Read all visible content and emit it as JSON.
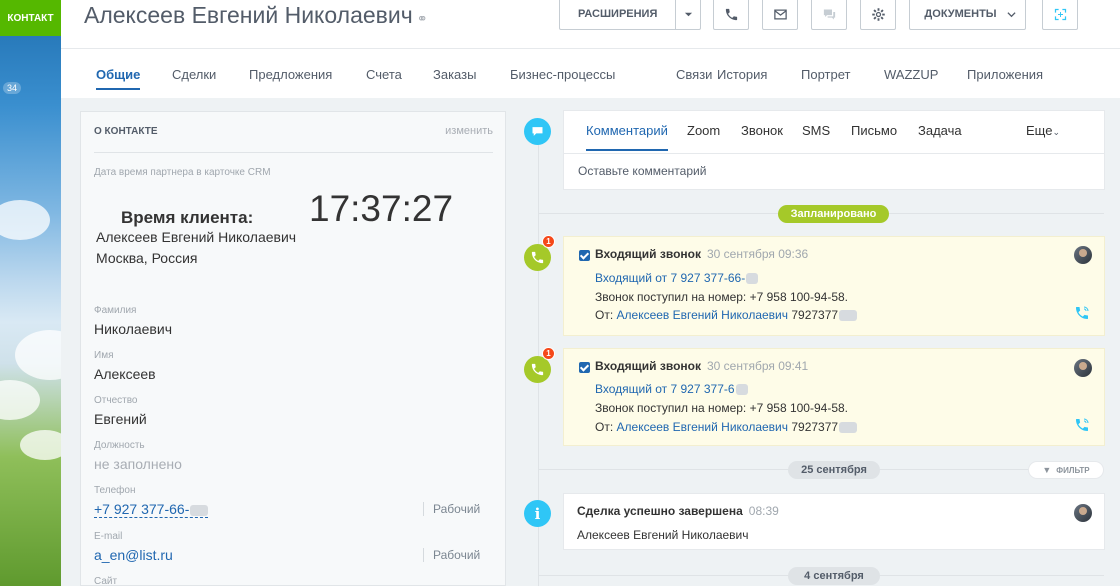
{
  "left_tab": "КОНТАКТ",
  "left_counter": "34",
  "header": {
    "title": "Алексеев Евгений  Николаевич",
    "extensions_label": "РАСШИРЕНИЯ",
    "documents_label": "ДОКУМЕНТЫ"
  },
  "tabs": [
    "Общие",
    "Сделки",
    "Предложения",
    "Счета",
    "Заказы",
    "Бизнес-процессы",
    "Связи",
    "История",
    "Портрет",
    "WAZZUP",
    "Приложения"
  ],
  "about": {
    "heading": "О КОНТАКТЕ",
    "edit": "изменить",
    "partner_time_label": "Дата время партнера в карточке CRM",
    "client_time_label": "Время клиента:",
    "client_name": "Алексеев Евгений Николаевич",
    "client_location": "Москва, Россия",
    "clock": "17:37:27",
    "fields": [
      {
        "label": "Фамилия",
        "value": "Николаевич"
      },
      {
        "label": "Имя",
        "value": "Алексеев"
      },
      {
        "label": "Отчество",
        "value": "Евгений"
      },
      {
        "label": "Должность",
        "value": "не заполнено"
      },
      {
        "label": "Телефон",
        "value": "+7 927 377-66-",
        "type": "Рабочий"
      },
      {
        "label": "E-mail",
        "value": "a_en@list.ru",
        "type": "Рабочий"
      },
      {
        "label": "Сайт",
        "value": ""
      }
    ]
  },
  "timeline": {
    "tabs": [
      "Комментарий",
      "Zoom",
      "Звонок",
      "SMS",
      "Письмо",
      "Задача",
      "Еще"
    ],
    "comment_placeholder": "Оставьте комментарий",
    "planned_label": "Запланировано",
    "badge_count": "1",
    "events": [
      {
        "title": "Входящий звонок",
        "date": "30 сентября 09:36",
        "link": "Входящий от 7 927 377-66-",
        "line2": "Звонок поступил на номер: +7 958 100-94-58.",
        "from_label": "От:",
        "from_name": "Алексеев Евгений Николаевич",
        "from_phone": "7927377"
      },
      {
        "title": "Входящий звонок",
        "date": "30 сентября 09:41",
        "link": "Входящий от 7 927 377-6",
        "line2": "Звонок поступил на номер: +7 958 100-94-58.",
        "from_label": "От:",
        "from_name": "Алексеев Евгений Николаевич",
        "from_phone": "7927377"
      }
    ],
    "date_sep_1": "25 сентября",
    "filter_label": "ФИЛЬТР",
    "deal": {
      "title": "Сделка успешно завершена",
      "time": "08:39",
      "name": "Алексеев Евгений Николаевич"
    },
    "date_sep_2": "4 сентября"
  },
  "colors": {
    "accent": "#2067b0",
    "green": "#55b800",
    "timeline_green": "#a5c929",
    "cyan": "#2fc6f6",
    "badge": "#f54819"
  }
}
